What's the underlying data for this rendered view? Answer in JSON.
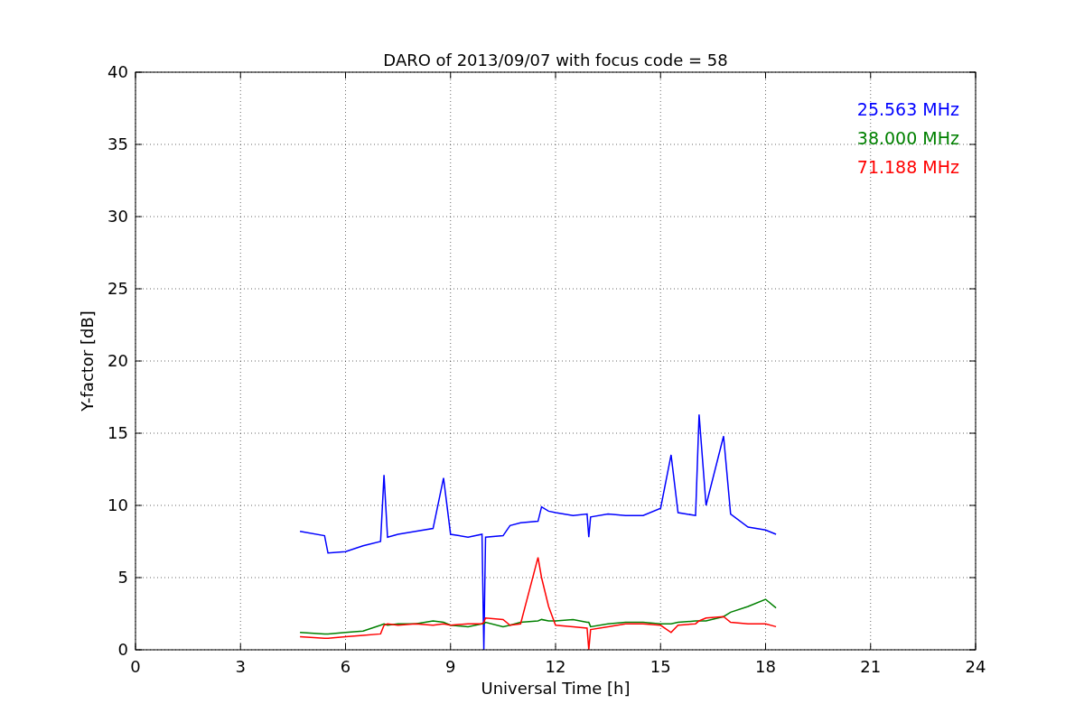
{
  "figure": {
    "chart_data": {
      "type": "line",
      "title": "DARO of 2013/09/07 with focus code = 58",
      "xlabel": "Universal Time [h]",
      "ylabel": "Y-factor [dB]",
      "x": [
        4.7,
        5.4,
        5.5,
        6,
        6.5,
        7,
        7.1,
        7.2,
        7.5,
        8,
        8.5,
        8.8,
        9,
        9.5,
        9.9,
        9.95,
        10,
        10.5,
        10.7,
        11,
        11.5,
        11.6,
        11.8,
        12,
        12.5,
        12.9,
        12.95,
        13,
        13.5,
        14,
        14.5,
        15,
        15.3,
        15.5,
        16,
        16.1,
        16.3,
        16.8,
        17,
        17.5,
        18,
        18.3
      ],
      "series": [
        {
          "name": "25.563 MHz",
          "color": "#0000ff",
          "values": [
            8.2,
            7.9,
            6.7,
            6.8,
            7.2,
            7.5,
            12.1,
            7.8,
            8.0,
            8.2,
            8.4,
            11.9,
            8.0,
            7.8,
            8.0,
            0,
            7.8,
            7.9,
            8.6,
            8.8,
            8.9,
            9.9,
            9.6,
            9.5,
            9.3,
            9.4,
            7.8,
            9.2,
            9.4,
            9.3,
            9.3,
            9.8,
            13.5,
            9.5,
            9.3,
            16.3,
            10.0,
            14.8,
            9.4,
            8.5,
            8.3,
            8.0
          ]
        },
        {
          "name": "38.000 MHz",
          "color": "#008000",
          "values": [
            1.2,
            1.1,
            1.1,
            1.2,
            1.3,
            1.7,
            1.8,
            1.7,
            1.8,
            1.8,
            2.0,
            1.9,
            1.7,
            1.6,
            1.8,
            1.8,
            1.9,
            1.6,
            1.7,
            1.9,
            2.0,
            2.1,
            2.0,
            2.0,
            2.1,
            1.9,
            1.9,
            1.6,
            1.8,
            1.9,
            1.9,
            1.8,
            1.8,
            1.9,
            2.0,
            2.0,
            2.0,
            2.3,
            2.6,
            3.0,
            3.5,
            2.9
          ]
        },
        {
          "name": "71.188 MHz",
          "color": "#ff0000",
          "values": [
            0.9,
            0.8,
            0.8,
            0.9,
            1.0,
            1.1,
            1.7,
            1.8,
            1.7,
            1.8,
            1.7,
            1.8,
            1.7,
            1.8,
            1.8,
            1.9,
            2.2,
            2.1,
            1.7,
            1.8,
            6.4,
            5.0,
            3.0,
            1.7,
            1.6,
            1.5,
            0,
            1.4,
            1.6,
            1.8,
            1.8,
            1.7,
            1.2,
            1.7,
            1.8,
            2.0,
            2.2,
            2.3,
            1.9,
            1.8,
            1.8,
            1.6
          ]
        }
      ],
      "xlim": [
        0,
        24
      ],
      "ylim": [
        0,
        40
      ],
      "xticks": [
        0,
        3,
        6,
        9,
        12,
        15,
        18,
        21,
        24
      ],
      "yticks": [
        0,
        5,
        10,
        15,
        20,
        25,
        30,
        35,
        40
      ],
      "grid": true
    }
  }
}
